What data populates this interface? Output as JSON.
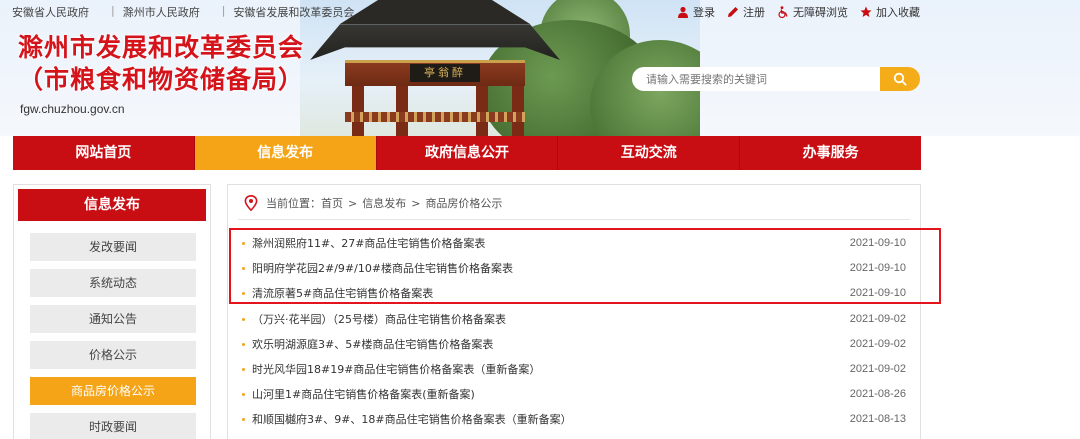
{
  "header": {
    "top_links": [
      "安徽省人民政府",
      "滁州市人民政府",
      "安徽省发展和改革委员会"
    ],
    "util_links": [
      {
        "label": "登录",
        "icon": "user-icon"
      },
      {
        "label": "注册",
        "icon": "pencil-icon"
      },
      {
        "label": "无障碍浏览",
        "icon": "wheelchair-icon"
      },
      {
        "label": "加入收藏",
        "icon": "star-icon"
      }
    ],
    "title_line1": "滁州市发展和改革委员会",
    "title_line2": "（市粮食和物资储备局）",
    "domain": "fgw.chuzhou.gov.cn",
    "plaque_text": "亭翁醉",
    "search_placeholder": "请输入需要搜索的关键词"
  },
  "nav": {
    "items": [
      "网站首页",
      "信息发布",
      "政府信息公开",
      "互动交流",
      "办事服务"
    ],
    "active_index": 1
  },
  "sidebar": {
    "heading": "信息发布",
    "items": [
      "发改要闻",
      "系统动态",
      "通知公告",
      "价格公示",
      "商品房价格公示",
      "时政要闻"
    ],
    "active_index": 4
  },
  "breadcrumb": {
    "prefix": "当前位置：",
    "path": [
      "首页",
      "信息发布",
      "商品房价格公示"
    ],
    "separator": ">"
  },
  "list": {
    "items": [
      {
        "title": "滁州润熙府11#、27#商品住宅销售价格备案表",
        "date": "2021-09-10"
      },
      {
        "title": "阳明府学花园2#/9#/10#楼商品住宅销售价格备案表",
        "date": "2021-09-10"
      },
      {
        "title": "清流原著5#商品住宅销售价格备案表",
        "date": "2021-09-10"
      },
      {
        "title": "（万兴·花半园）（25号楼）商品住宅销售价格备案表",
        "date": "2021-09-02"
      },
      {
        "title": "欢乐明湖源庭3#、5#楼商品住宅销售价格备案表",
        "date": "2021-09-02"
      },
      {
        "title": "时光风华园18#19#商品住宅销售价格备案表（重新备案）",
        "date": "2021-09-02"
      },
      {
        "title": "山河里1#商品住宅销售价格备案表(重新备案)",
        "date": "2021-08-26"
      },
      {
        "title": "和顺国樾府3#、9#、18#商品住宅销售价格备案表（重新备案）",
        "date": "2021-08-13"
      }
    ]
  },
  "colors": {
    "brand_red": "#c80d13",
    "accent_orange": "#f4a416",
    "highlight_red": "#e3141b"
  }
}
